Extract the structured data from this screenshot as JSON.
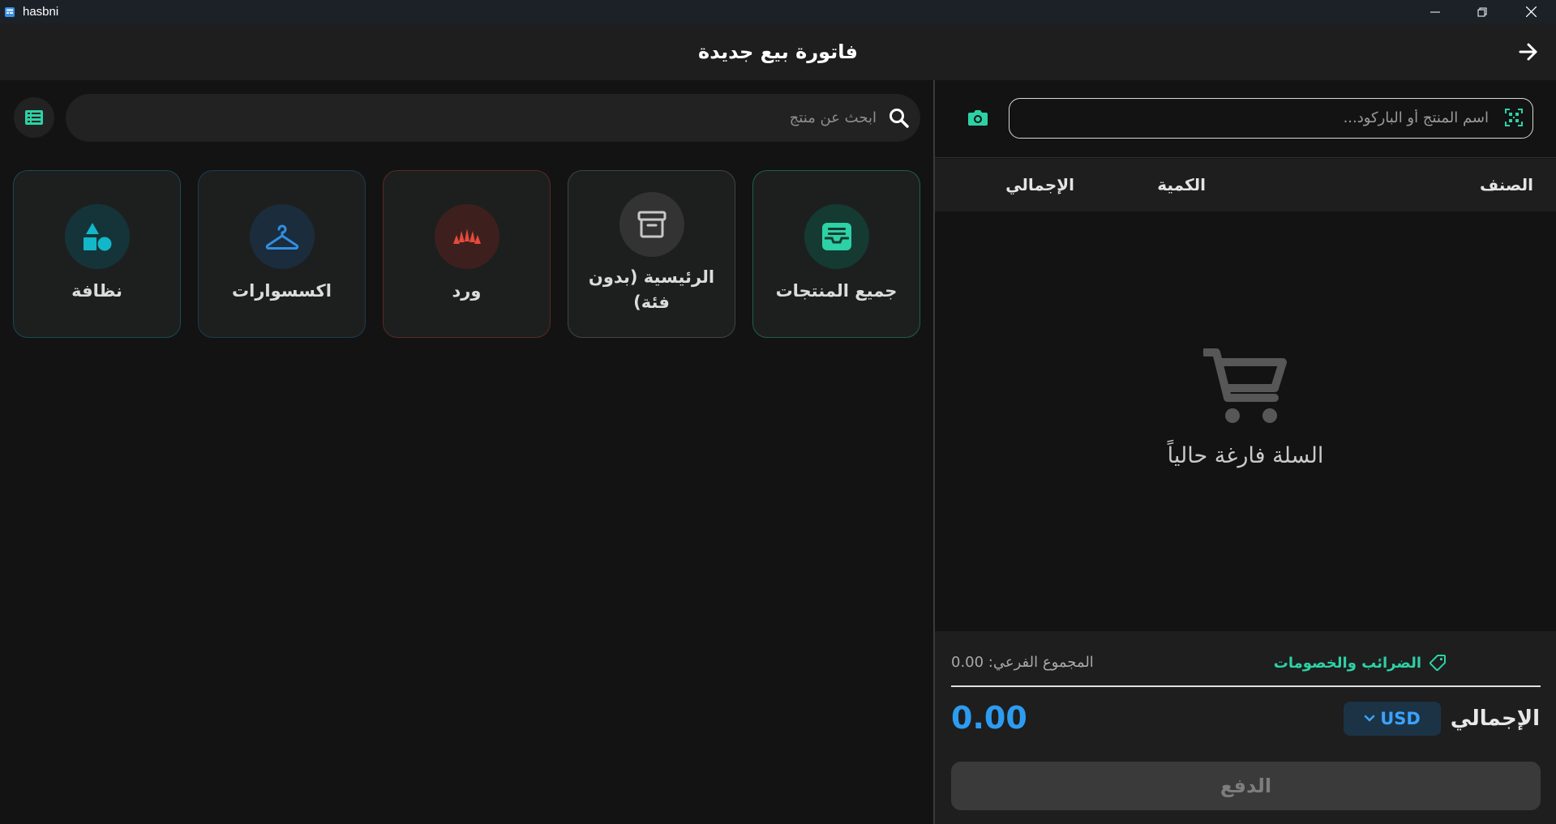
{
  "window": {
    "app_name": "hasbni"
  },
  "header": {
    "title": "فاتورة بيع جديدة"
  },
  "left": {
    "search_placeholder": "ابحث عن منتج",
    "categories": [
      {
        "label": "جميع المنتجات",
        "icon": "inbox-icon",
        "color": "#2dd1a6"
      },
      {
        "label": "الرئيسية (بدون فئة)",
        "icon": "archive-icon",
        "color": "#c8c8c8"
      },
      {
        "label": "ورد",
        "icon": "flower-icon",
        "color": "#e64a3b"
      },
      {
        "label": "اكسسوارات",
        "icon": "hanger-icon",
        "color": "#2f8fe0"
      },
      {
        "label": "نظافة",
        "icon": "shapes-icon",
        "color": "#12b8c9"
      }
    ]
  },
  "right": {
    "barcode_placeholder": "اسم المنتج أو الباركود...",
    "columns": {
      "item": "الصنف",
      "quantity": "الكمية",
      "total": "الإجمالي"
    },
    "empty_message": "السلة فارغة حالياً",
    "taxes_label": "الضرائب والخصومات",
    "subtotal": "المجموع الفرعي: 0.00",
    "total_label": "الإجمالي",
    "currency": "USD",
    "total_value": "0.00",
    "pay_label": "الدفع"
  }
}
